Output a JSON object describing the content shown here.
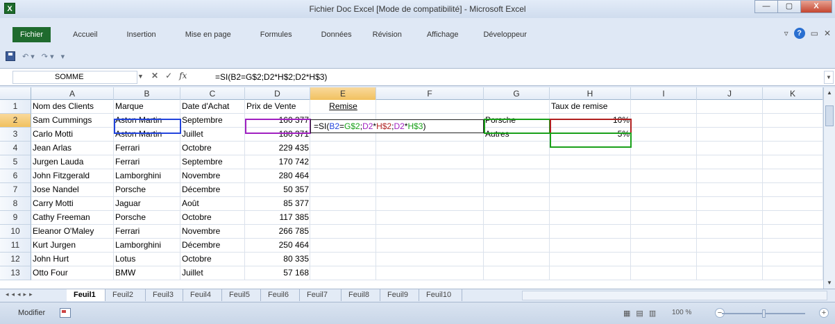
{
  "window": {
    "title": "Fichier Doc Excel [Mode de compatibilité] - Microsoft Excel",
    "controls": [
      "—",
      "▢",
      "X"
    ]
  },
  "ribbon": {
    "tabs": [
      "Fichier",
      "Accueil",
      "Insertion",
      "Mise en page",
      "Formules",
      "Données",
      "Révision",
      "Affichage",
      "Développeur"
    ]
  },
  "qat": {
    "undo": "↶ ▾",
    "redo": "↷ ▾",
    "more": "▾"
  },
  "formula_bar": {
    "name_box": "SOMME",
    "cancel": "✕",
    "enter": "✓",
    "fx": "fx",
    "formula": "=SI(B2=G$2;D2*H$2;D2*H$3)"
  },
  "columns": [
    "A",
    "B",
    "C",
    "D",
    "E",
    "F",
    "G",
    "H",
    "I",
    "J",
    "K"
  ],
  "rows": [
    "1",
    "2",
    "3",
    "4",
    "5",
    "6",
    "7",
    "8",
    "9",
    "10",
    "11",
    "12",
    "13"
  ],
  "table": {
    "headers": [
      "Nom des Clients",
      "Marque",
      "Date d'Achat",
      "Prix de Vente",
      "Remise"
    ],
    "data": [
      [
        "Sam Cummings",
        "Aston Martin",
        "Septembre",
        "160 377"
      ],
      [
        "Carlo Motti",
        "Aston Martin",
        "Juillet",
        "180 371"
      ],
      [
        "Jean Arlas",
        "Ferrari",
        "Octobre",
        "229 435"
      ],
      [
        "Jurgen Lauda",
        "Ferrari",
        "Septembre",
        "170 742"
      ],
      [
        "John Fitzgerald",
        "Lamborghini",
        "Novembre",
        "280 464"
      ],
      [
        "Jose Nandel",
        "Porsche",
        "Décembre",
        "50 357"
      ],
      [
        "Carry Motti",
        "Jaguar",
        "Août",
        "85 377"
      ],
      [
        "Cathy Freeman",
        "Porsche",
        "Octobre",
        "117 385"
      ],
      [
        "Eleanor O'Maley",
        "Ferrari",
        "Novembre",
        "266 785"
      ],
      [
        "Kurt Jurgen",
        "Lamborghini",
        "Décembre",
        "250 464"
      ],
      [
        "John Hurt",
        "Lotus",
        "Octobre",
        "80 335"
      ],
      [
        "Otto Four",
        "BMW",
        "Juillet",
        "57 168"
      ]
    ],
    "edit_formula_parts": [
      "=SI(",
      "B2",
      "=",
      "G$2",
      ";",
      "D2",
      "*",
      "H$2",
      ";",
      "D2",
      "*",
      "H$3",
      ")"
    ]
  },
  "rate_table": {
    "header": "Taux de remise",
    "rows": [
      {
        "label": "Porsche",
        "value": "10%"
      },
      {
        "label": "Autres",
        "value": "5%"
      }
    ]
  },
  "sheets": [
    "Feuil1",
    "Feuil2",
    "Feuil3",
    "Feuil4",
    "Feuil5",
    "Feuil6",
    "Feuil7",
    "Feuil8",
    "Feuil9",
    "Feuil10"
  ],
  "active_sheet": "Feuil1",
  "status": {
    "mode": "Modifier",
    "zoom": "100 %"
  }
}
